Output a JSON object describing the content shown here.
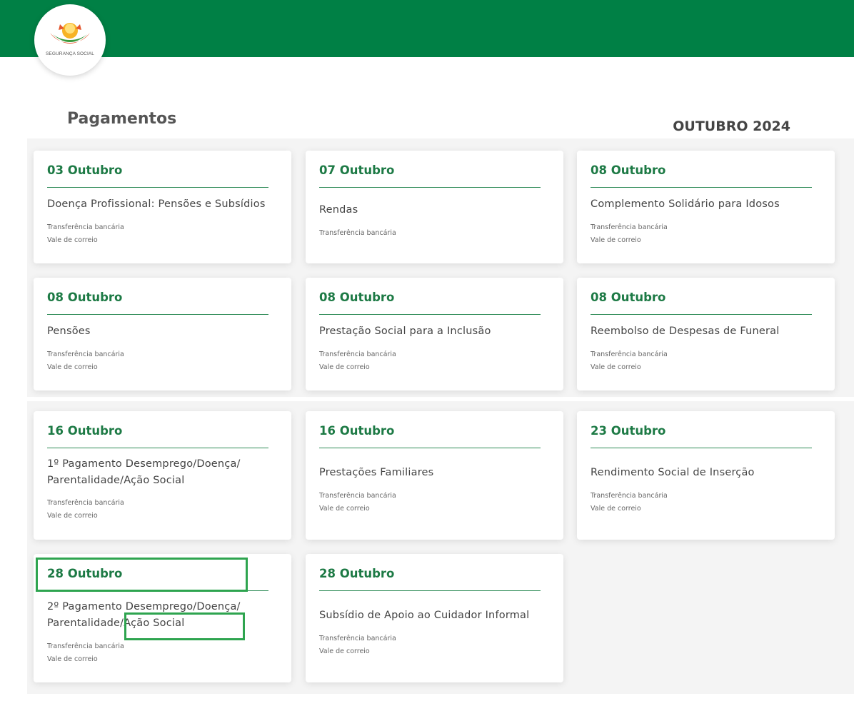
{
  "header": {
    "logo_text": "SEGURANÇA SOCIAL",
    "brand_color": "#008045"
  },
  "page": {
    "title": "Pagamentos",
    "month": "OUTUBRO 2024"
  },
  "cards": [
    {
      "date": "03 Outubro",
      "title_lines": [
        "Doença Profissional: Pensões e Subsídios"
      ],
      "methods": [
        "Transferência bancária",
        "Vale de correio"
      ]
    },
    {
      "date": "07 Outubro",
      "title_lines": [
        "Rendas"
      ],
      "methods": [
        "Transferência bancária"
      ]
    },
    {
      "date": "08 Outubro",
      "title_lines": [
        "Complemento Solidário para Idosos"
      ],
      "methods": [
        "Transferência bancária",
        "Vale de correio"
      ]
    },
    {
      "date": "08 Outubro",
      "title_lines": [
        "Pensões"
      ],
      "methods": [
        "Transferência bancária",
        "Vale de correio"
      ]
    },
    {
      "date": "08 Outubro",
      "title_lines": [
        "Prestação Social para a Inclusão"
      ],
      "methods": [
        "Transferência bancária",
        "Vale de correio"
      ]
    },
    {
      "date": "08 Outubro",
      "title_lines": [
        "Reembolso de Despesas de Funeral"
      ],
      "methods": [
        "Transferência bancária",
        "Vale de correio"
      ]
    },
    {
      "date": "16 Outubro",
      "title_lines": [
        "1º Pagamento Desemprego/Doença/",
        "Parentalidade/Ação Social"
      ],
      "methods": [
        "Transferência bancária",
        "Vale de correio"
      ]
    },
    {
      "date": "16 Outubro",
      "title_lines": [
        "Prestações Familiares"
      ],
      "methods": [
        "Transferência bancária",
        "Vale de correio"
      ]
    },
    {
      "date": "23 Outubro",
      "title_lines": [
        "Rendimento Social de Inserção"
      ],
      "methods": [
        "Transferência bancária",
        "Vale de correio"
      ]
    },
    {
      "date": "28 Outubro",
      "title_lines": [
        "2º Pagamento Desemprego/Doença/",
        "Parentalidade/Ação Social"
      ],
      "methods": [
        "Transferência bancária",
        "Vale de correio"
      ]
    },
    {
      "date": "28 Outubro",
      "title_lines": [
        "Subsídio de Apoio ao Cuidador Informal"
      ],
      "methods": [
        "Transferência bancária",
        "Vale de correio"
      ]
    }
  ]
}
